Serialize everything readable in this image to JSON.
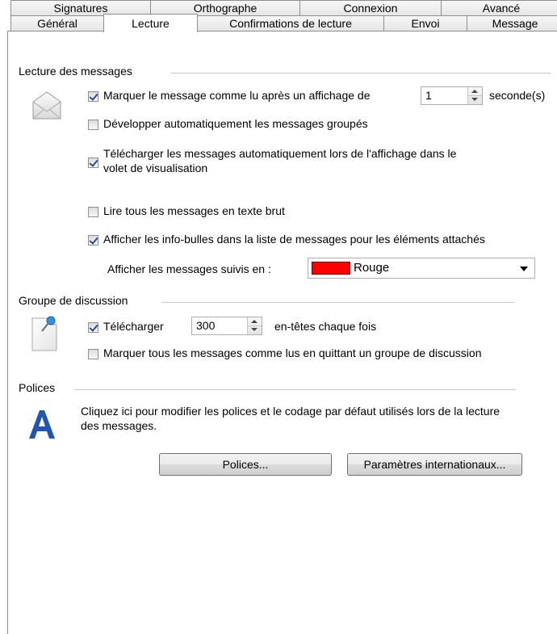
{
  "tabs": {
    "row_top": [
      "Signatures",
      "Orthographe",
      "Connexion",
      "Avancé"
    ],
    "row_bottom": [
      "Général",
      "Lecture",
      "Confirmations de lecture",
      "Envoi",
      "Message"
    ]
  },
  "reading": {
    "header": "Lecture des messages",
    "mark_read_label": "Marquer le message comme lu après un affichage de",
    "mark_read_seconds": "1",
    "seconds_unit": "seconde(s)",
    "expand_label": "Développer automatiquement les messages groupés",
    "download_label_line1": "Télécharger les messages automatiquement lors de l'affichage dans le",
    "download_label_line2": "volet de visualisation",
    "plain_text_label": "Lire tous les messages en texte brut",
    "tooltips_label": "Afficher les info-bulles dans la liste de messages pour les éléments attachés",
    "watched_label": "Afficher les messages suivis en :",
    "watched_color_name": "Rouge",
    "watched_color": "#ff0000"
  },
  "newsgroup": {
    "header": "Groupe de discussion",
    "download_label": "Télécharger",
    "download_count": "300",
    "headers_label": "en-têtes chaque fois",
    "mark_all_label": "Marquer tous les messages comme lus en quittant un groupe de discussion"
  },
  "fonts": {
    "header": "Polices",
    "desc_line1": "Cliquez ici pour modifier les polices et le codage par défaut utilisés lors de la lecture",
    "desc_line2": "des messages.",
    "fonts_button": "Polices...",
    "intl_button": "Paramètres internationaux..."
  }
}
